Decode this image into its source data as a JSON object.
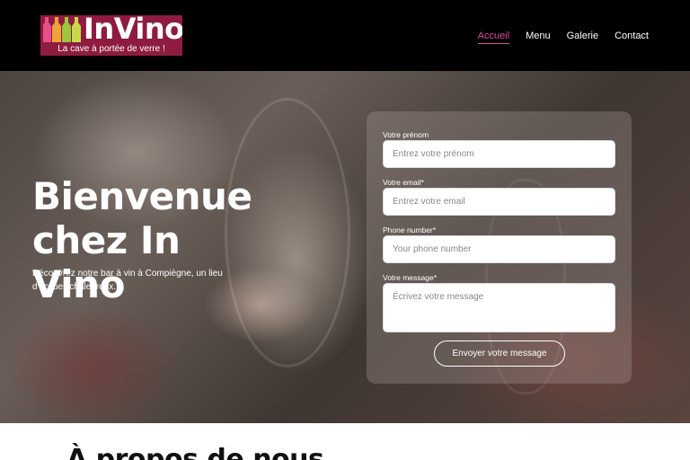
{
  "brand": {
    "name": "InVino",
    "tagline": "La cave à portée de verre !",
    "logo_bg": "#8e1c40"
  },
  "nav": {
    "items": [
      {
        "label": "Accueil",
        "active": true
      },
      {
        "label": "Menu",
        "active": false
      },
      {
        "label": "Galerie",
        "active": false
      },
      {
        "label": "Contact",
        "active": false
      }
    ],
    "active_color": "#e24aa3"
  },
  "hero": {
    "title": "Bienvenue chez In Vino",
    "subtitle": "Découvrez notre bar à vin à Compiègne, un lieu d'accueil chaleureux."
  },
  "form": {
    "firstname_label": "Votre prénom",
    "firstname_placeholder": "Entrez votre prénom",
    "email_label": "Votre email*",
    "email_placeholder": "Entrez votre email",
    "phone_label": "Phone number*",
    "phone_placeholder": "Your phone number",
    "message_label": "Votre message*",
    "message_placeholder": "Écrivez votre message",
    "submit_label": "Envoyer votre message"
  },
  "about": {
    "heading": "À propos de nous"
  }
}
